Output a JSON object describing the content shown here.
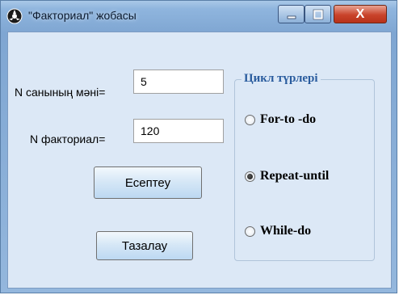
{
  "window": {
    "title": "\"Факториал\" жобасы",
    "close_label": "X"
  },
  "form": {
    "n_label": "N санының мәні=",
    "n_value": "5",
    "fact_label": "N факториал=",
    "fact_value": "120",
    "calc_button": "Есептеу",
    "clear_button": "Тазалау"
  },
  "loops": {
    "title": "Цикл түрлері",
    "options": [
      {
        "label": "For-to -do",
        "selected": false
      },
      {
        "label": "Repeat-until",
        "selected": true
      },
      {
        "label": "While-do",
        "selected": false
      }
    ]
  },
  "colors": {
    "title_bar": "#8fb5de",
    "client": "#dce8f6",
    "group_title": "#2a5c9e",
    "close_button": "#c9432b"
  }
}
